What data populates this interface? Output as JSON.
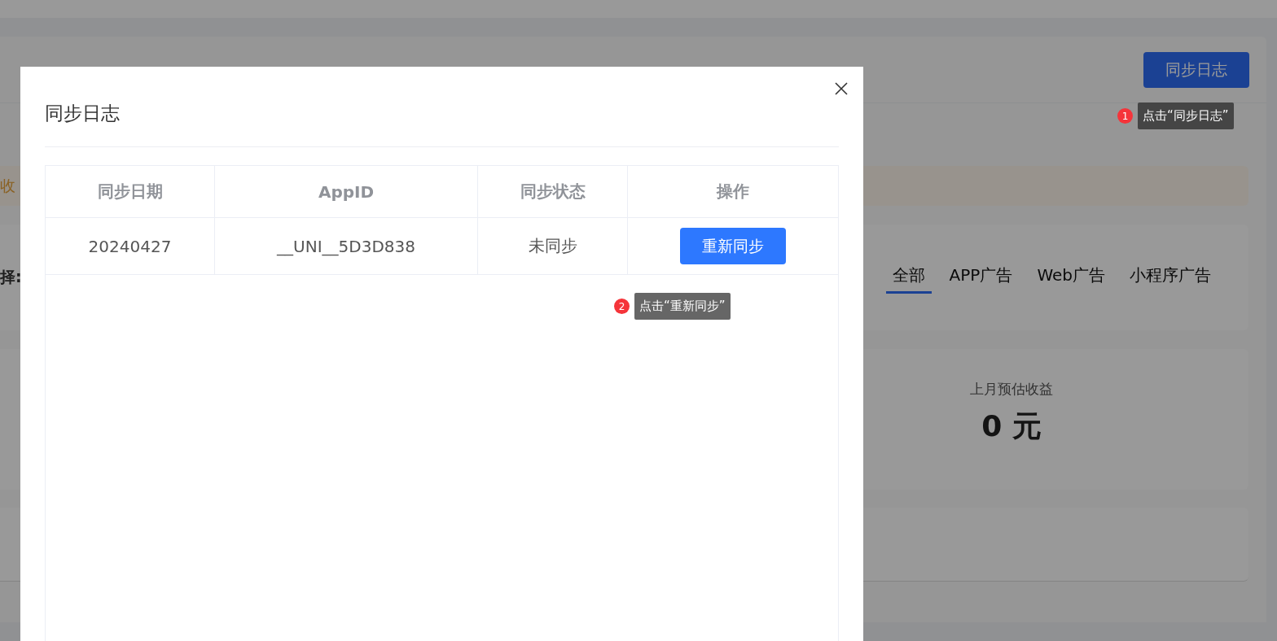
{
  "page": {
    "log_button": "同步日志",
    "alert_text": "收",
    "filter_label": "择:",
    "tabs": [
      {
        "label": "全部",
        "selected": true
      },
      {
        "label": "APP广告",
        "selected": false
      },
      {
        "label": "Web广告",
        "selected": false
      },
      {
        "label": "小程序广告",
        "selected": false
      }
    ],
    "stat": {
      "label": "上月预估收益",
      "value": "0 元"
    }
  },
  "dialog": {
    "title": "同步日志",
    "columns": [
      "同步日期",
      "AppID",
      "同步状态",
      "操作"
    ],
    "rows": [
      {
        "date": "20240427",
        "app_id": "__UNI__5D3D838",
        "status": "未同步",
        "action": "重新同步"
      }
    ]
  },
  "hints": [
    {
      "number": "1",
      "text": "点击“同步日志”"
    },
    {
      "number": "2",
      "text": "点击“重新同步”"
    }
  ]
}
